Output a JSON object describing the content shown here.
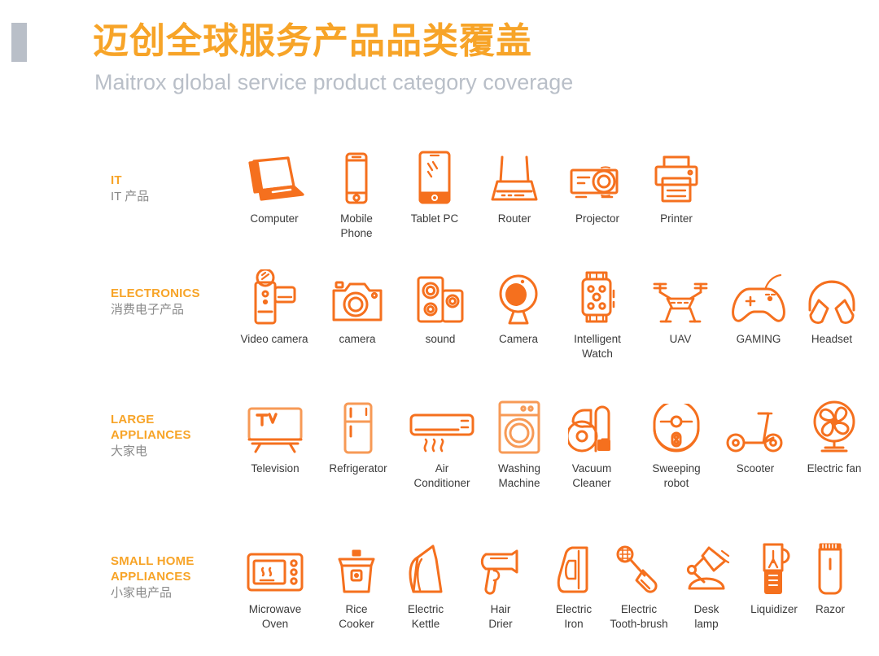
{
  "header": {
    "title": "迈创全球服务产品品类覆盖",
    "subtitle": "Maitrox global service product category coverage",
    "accent_bar_color": "#b9bfc8",
    "title_color": "#f7a428",
    "subtitle_color": "#b9bfc8"
  },
  "colors": {
    "icon_orange": "#f5701e",
    "icon_orange_light": "#f79a56",
    "category_orange": "#f7a428",
    "label_gray": "#3b3b3b",
    "cn_label_gray": "#8a8a8a",
    "background": "#ffffff"
  },
  "categories": [
    {
      "id": "it",
      "label_en": "IT",
      "label_cn": "IT 产品",
      "items": [
        {
          "label": "Computer",
          "icon": "laptop-icon"
        },
        {
          "label": "Mobile\nPhone",
          "icon": "mobile-phone-icon"
        },
        {
          "label": "Tablet PC",
          "icon": "tablet-icon"
        },
        {
          "label": "Router",
          "icon": "router-icon"
        },
        {
          "label": "Projector",
          "icon": "projector-icon"
        },
        {
          "label": "Printer",
          "icon": "printer-icon"
        }
      ]
    },
    {
      "id": "electronics",
      "label_en": "ELECTRONICS",
      "label_cn": "消费电子产品",
      "items": [
        {
          "label": "Video camera",
          "icon": "video-camera-icon"
        },
        {
          "label": "camera",
          "icon": "camera-icon"
        },
        {
          "label": "sound",
          "icon": "speaker-icon"
        },
        {
          "label": "Camera",
          "icon": "webcam-icon"
        },
        {
          "label": "Intelligent\nWatch",
          "icon": "smart-watch-icon"
        },
        {
          "label": "UAV",
          "icon": "drone-icon"
        },
        {
          "label": "GAMING",
          "icon": "gamepad-icon"
        },
        {
          "label": "Headset",
          "icon": "headset-icon"
        }
      ]
    },
    {
      "id": "large-appliances",
      "label_en": "LARGE\nAPPLIANCES",
      "label_cn": "大家电",
      "items": [
        {
          "label": "Television",
          "icon": "television-icon"
        },
        {
          "label": "Refrigerator",
          "icon": "refrigerator-icon"
        },
        {
          "label": "Air\nConditioner",
          "icon": "air-conditioner-icon"
        },
        {
          "label": "Washing\nMachine",
          "icon": "washing-machine-icon"
        },
        {
          "label": "Vacuum\nCleaner",
          "icon": "vacuum-cleaner-icon"
        },
        {
          "label": "Sweeping\nrobot",
          "icon": "sweeping-robot-icon"
        },
        {
          "label": "Scooter",
          "icon": "scooter-icon"
        },
        {
          "label": "Electric fan",
          "icon": "electric-fan-icon"
        }
      ]
    },
    {
      "id": "small-home-appliances",
      "label_en": "SMALL HOME\nAPPLIANCES",
      "label_cn": "小家电产品",
      "items": [
        {
          "label": "Microwave\nOven",
          "icon": "microwave-oven-icon"
        },
        {
          "label": "Rice\nCooker",
          "icon": "rice-cooker-icon"
        },
        {
          "label": "Electric\nKettle",
          "icon": "electric-kettle-icon"
        },
        {
          "label": "Hair\nDrier",
          "icon": "hair-drier-icon"
        },
        {
          "label": "Electric\nIron",
          "icon": "electric-iron-icon"
        },
        {
          "label": "Electric\nTooth-brush",
          "icon": "electric-toothbrush-icon"
        },
        {
          "label": "Desk\nlamp",
          "icon": "desk-lamp-icon"
        },
        {
          "label": "Liquidizer",
          "icon": "liquidizer-icon"
        },
        {
          "label": "Razor",
          "icon": "razor-icon"
        }
      ]
    }
  ]
}
